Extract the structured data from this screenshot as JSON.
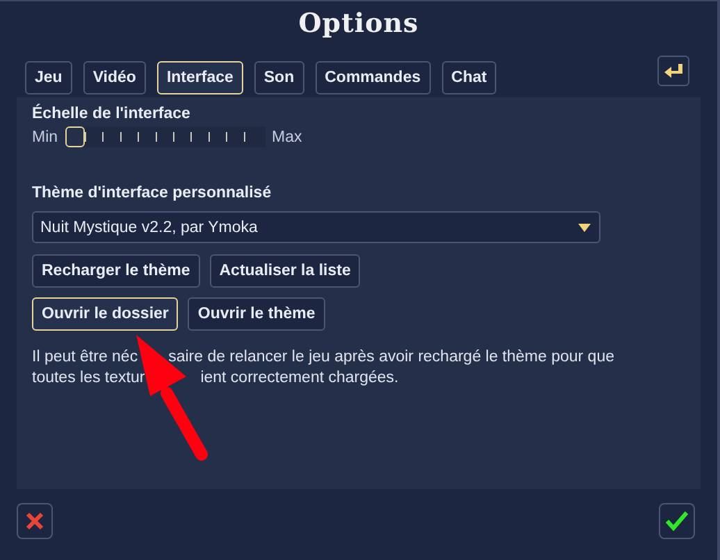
{
  "window": {
    "title": "Options"
  },
  "tabs": [
    {
      "label": "Jeu",
      "selected": false
    },
    {
      "label": "Vidéo",
      "selected": false
    },
    {
      "label": "Interface",
      "selected": true
    },
    {
      "label": "Son",
      "selected": false
    },
    {
      "label": "Commandes",
      "selected": false
    },
    {
      "label": "Chat",
      "selected": false
    }
  ],
  "scale": {
    "label": "Échelle de l'interface",
    "min_label": "Min",
    "max_label": "Max",
    "level": 0
  },
  "theme": {
    "label": "Thème d'interface personnalisé",
    "value": "Nuit Mystique v2.2, par Ymoka"
  },
  "buttons": [
    {
      "label": "Recharger le thème",
      "selected": false
    },
    {
      "label": "Actualiser la liste",
      "selected": false
    },
    {
      "label": "Ouvrir le dossier",
      "selected": true
    },
    {
      "label": "Ouvrir le thème",
      "selected": false
    }
  ],
  "note_lines": [
    [
      "Il peut être néc",
      "saire de relancer le jeu après avoir rechargé le thème pour que"
    ],
    [
      "toutes les textur",
      "ient correctement chargées."
    ]
  ],
  "annotation": {
    "kind": "arrow"
  }
}
